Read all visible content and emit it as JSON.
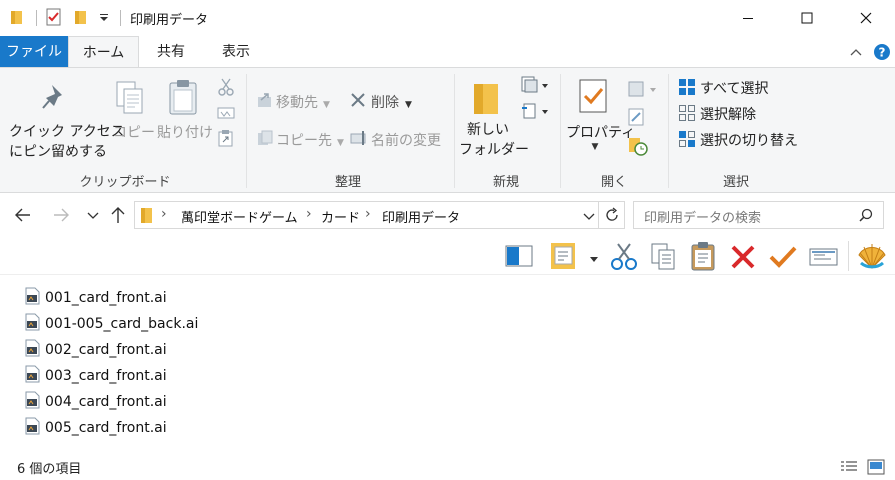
{
  "window": {
    "title": "印刷用データ"
  },
  "tabs": [
    {
      "label": "ファイル"
    },
    {
      "label": "ホーム"
    },
    {
      "label": "共有"
    },
    {
      "label": "表示"
    }
  ],
  "ribbon": {
    "clipboard": {
      "pin_line1": "クイック アクセス",
      "pin_line2": "にピン留めする",
      "copy": "コピー",
      "paste": "貼り付け",
      "label": "クリップボード"
    },
    "organize": {
      "move_to": "移動先",
      "copy_to": "コピー先",
      "delete": "削除",
      "rename": "名前の変更",
      "label": "整理"
    },
    "new": {
      "folder_line1": "新しい",
      "folder_line2": "フォルダー",
      "label": "新規"
    },
    "open": {
      "properties": "プロパティ",
      "label": "開く"
    },
    "select": {
      "select_all": "すべて選択",
      "select_none": "選択解除",
      "invert": "選択の切り替え",
      "label": "選択"
    }
  },
  "address": {
    "crumbs": [
      "萬印堂ボードゲーム",
      "カード",
      "印刷用データ"
    ],
    "separator": "›"
  },
  "search": {
    "placeholder": "印刷用データの検索"
  },
  "files": [
    {
      "name": "001_card_front.ai"
    },
    {
      "name": "001-005_card_back.ai"
    },
    {
      "name": "002_card_front.ai"
    },
    {
      "name": "003_card_front.ai"
    },
    {
      "name": "004_card_front.ai"
    },
    {
      "name": "005_card_front.ai"
    }
  ],
  "status": {
    "count": "6 個の項目"
  },
  "colors": {
    "accent": "#1979ca",
    "folder": "#f3c24b",
    "delete_red": "#d9292b",
    "check_orange": "#e07a20"
  }
}
